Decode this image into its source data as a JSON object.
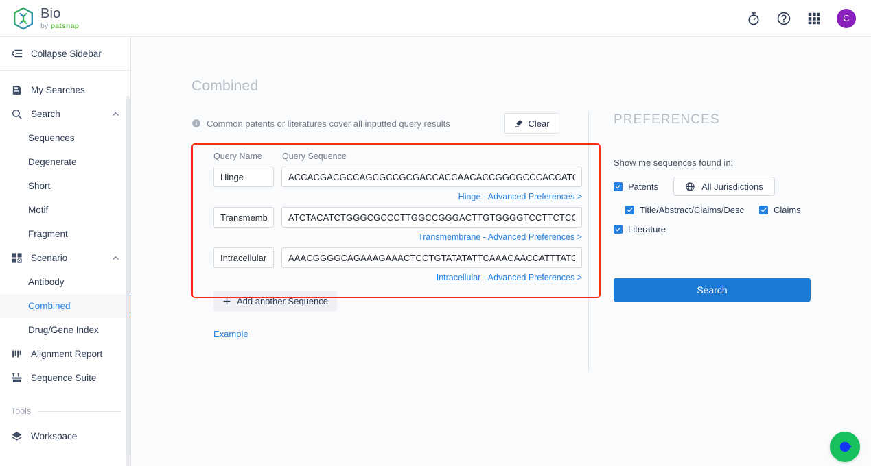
{
  "header": {
    "brand_title": "Bio",
    "brand_sub_prefix": "by ",
    "brand_sub_name": "patsnap",
    "icons": [
      "stopwatch-icon",
      "help-icon",
      "apps-grid-icon"
    ],
    "avatar_initial": "C"
  },
  "sidebar": {
    "collapse_label": "Collapse Sidebar",
    "items": [
      {
        "label": "My Searches",
        "icon": "saved-document-icon",
        "type": "item"
      },
      {
        "label": "Search",
        "icon": "search-icon",
        "type": "group",
        "expanded": true
      },
      {
        "label": "Sequences",
        "type": "sub"
      },
      {
        "label": "Degenerate",
        "type": "sub"
      },
      {
        "label": "Short",
        "type": "sub"
      },
      {
        "label": "Motif",
        "type": "sub"
      },
      {
        "label": "Fragment",
        "type": "sub"
      },
      {
        "label": "Scenario",
        "icon": "scenario-grid-icon",
        "type": "group",
        "expanded": true
      },
      {
        "label": "Antibody",
        "type": "sub"
      },
      {
        "label": "Combined",
        "type": "sub",
        "active": true
      },
      {
        "label": "Drug/Gene Index",
        "type": "sub"
      },
      {
        "label": "Alignment Report",
        "icon": "alignment-bars-icon",
        "type": "item"
      },
      {
        "label": "Sequence Suite",
        "icon": "sequence-suite-icon",
        "type": "item"
      }
    ],
    "section_tools_label": "Tools",
    "tools_items": [
      {
        "label": "Workspace",
        "icon": "workspace-layers-icon"
      }
    ]
  },
  "main": {
    "page_title": "Combined",
    "info_text": "Common patents or literatures cover all inputted query results",
    "clear_label": "Clear",
    "col_header_name": "Query Name",
    "col_header_sequence": "Query Sequence",
    "rows": [
      {
        "name": "Hinge",
        "sequence": "ACCACGACGCCAGCGCCGCGACCACCAACACCGGCGCCCACCATCG",
        "advanced_link": "Hinge - Advanced Preferences >"
      },
      {
        "name": "Transmembrane",
        "sequence": "ATCTACATCTGGGCGCCCTTGGCCGGGACTTGTGGGGTCCTTCTCCTG",
        "advanced_link": "Transmembrane - Advanced Preferences >"
      },
      {
        "name": "Intracellular",
        "sequence": "AAACGGGGCAGAAAGAAACTCCTGTATATATTCAAACAACCATTTATGA",
        "advanced_link": "Intracellular - Advanced Preferences >"
      }
    ],
    "add_sequence_label": "Add another Sequence",
    "example_label": "Example"
  },
  "preferences": {
    "title": "PREFERENCES",
    "lead": "Show me sequences found in:",
    "patents_label": "Patents",
    "jurisdictions_label": "All Jurisdictions",
    "title_abstract_label": "Title/Abstract/Claims/Desc",
    "claims_label": "Claims",
    "literature_label": "Literature",
    "search_label": "Search"
  },
  "colors": {
    "accent_blue": "#2681e0",
    "primary_button": "#1a7ad4",
    "annotation_red": "#f92d12",
    "avatar_purple": "#8b21bd",
    "chat_green": "#17c25e"
  }
}
